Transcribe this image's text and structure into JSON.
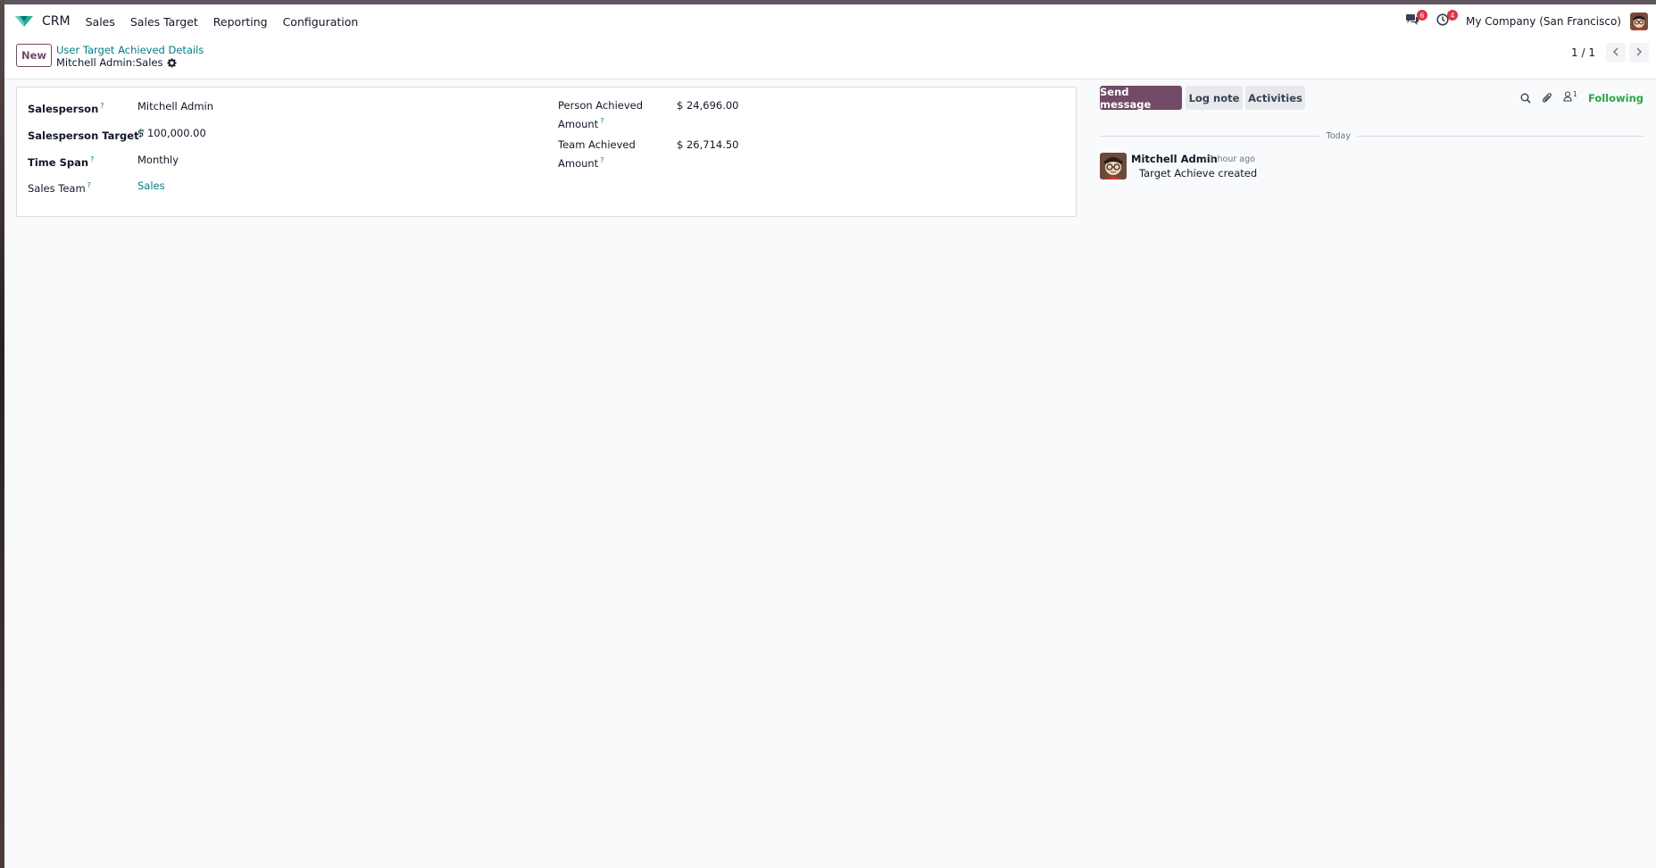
{
  "navbar": {
    "app_name": "CRM",
    "menu": [
      "Sales",
      "Sales Target",
      "Reporting",
      "Configuration"
    ],
    "messages_badge": "6",
    "activities_badge": "4",
    "company": "My Company (San Francisco)"
  },
  "control_panel": {
    "new_label": "New",
    "breadcrumb_parent": "User Target Achieved Details",
    "breadcrumb_current": "Mitchell Admin:Sales",
    "pager_value": "1 / 1"
  },
  "form": {
    "salesperson_label": "Salesperson",
    "salesperson_value": "Mitchell Admin",
    "target_label": "Salesperson Target",
    "target_value": "$ 100,000.00",
    "timespan_label": "Time Span",
    "timespan_value": "Monthly",
    "team_label": "Sales Team",
    "team_value": "Sales",
    "person_achieved_label_1": "Person Achieved",
    "person_achieved_label_2": "Amount",
    "person_achieved_value": "$ 24,696.00",
    "team_achieved_label_1": "Team Achieved",
    "team_achieved_label_2": "Amount",
    "team_achieved_value": "$ 26,714.50",
    "help_mark": "?"
  },
  "chatter": {
    "send_message": "Send message",
    "log_note": "Log note",
    "activities": "Activities",
    "follower_count": "1",
    "following": "Following",
    "date_separator": "Today",
    "message": {
      "author": "Mitchell Admin",
      "time": "- 1 hour ago",
      "body": "Target Achieve created"
    }
  },
  "colors": {
    "brand": "#714b67",
    "link": "#017e84",
    "following": "#28a745",
    "badge": "#dc3545"
  }
}
